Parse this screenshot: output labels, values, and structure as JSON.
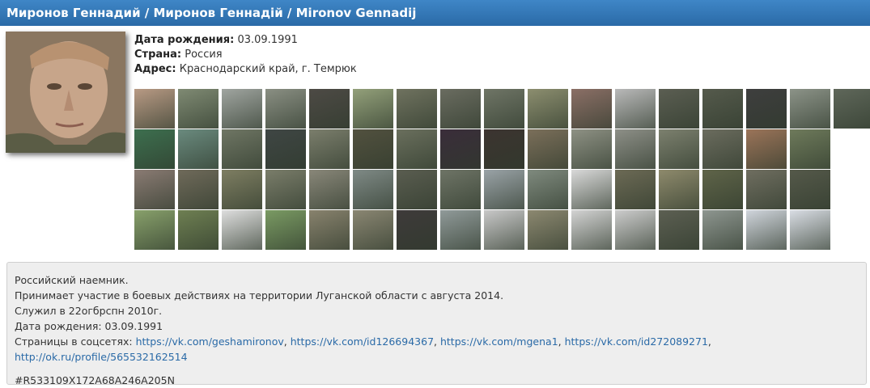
{
  "header": {
    "title": "Миронов Геннадий / Миронов Геннадій / Mironov Gennadij"
  },
  "info": [
    {
      "label": "Дата рождения:",
      "value": "03.09.1991"
    },
    {
      "label": "Страна:",
      "value": "Россия"
    },
    {
      "label": "Адрес:",
      "value": "Краснодарский край, г. Темрюк"
    }
  ],
  "photo_rows": [
    [
      "#b89a84",
      "#7f8a73",
      "#a0a5a0",
      "#8a8f83",
      "#4d4a45",
      "#93a07a",
      "#6f725f",
      "#6a6c60",
      "#6f7566",
      "#8c8e6f",
      "#8b6f66",
      "#b9b9b9",
      "#5b5e52",
      "#555a4c",
      "#3e3e3e",
      "#8c9388",
      "#5f675a"
    ],
    [
      "#3d6f4f",
      "#6a8a7e",
      "#6f7664",
      "#3f4644",
      "#7b7e6c",
      "#52513f",
      "#6a6f5d",
      "#3a2d3a",
      "#3c3430",
      "#7b6f5a",
      "#8e9184",
      "#8d8f87",
      "#7c806e",
      "#6b6c5e",
      "#9b7459",
      "#6e7a5b"
    ],
    [
      "#8a7b73",
      "#6f6a5a",
      "#7e7e62",
      "#7a7d6a",
      "#898779",
      "#7f8a86",
      "#5a5d50",
      "#6e7466",
      "#9aa3a7",
      "#7f8a7e",
      "#d9d9d9",
      "#6c6a55",
      "#8e8a6c",
      "#5f6449",
      "#6f6e60",
      "#55594a"
    ],
    [
      "#88a06b",
      "#6e7f52",
      "#dedede",
      "#7a9a63",
      "#88826d",
      "#8a8672",
      "#3e3a3a",
      "#909a99",
      "#c8c8c8",
      "#8c8870",
      "#d3d3d3",
      "#cccccc",
      "#5c5f52",
      "#8e9690",
      "#d0d5dc",
      "#d9dde4"
    ]
  ],
  "description": {
    "lines": [
      "Российский наемник.",
      "Принимает участие в боевых действиях на территории Луганской области с августа 2014.",
      "Служил в 22огбрспн 2010г.",
      "Дата рождения: 03.09.1991"
    ],
    "socials_label": "Страницы в соцсетях:",
    "links": [
      "https://vk.com/geshamironov",
      "https://vk.com/id126694367",
      "https://vk.com/mgena1",
      "https://vk.com/id272089271",
      "http://ok.ru/profile/565532162514"
    ],
    "tag": "#R533109X172A68A246A205N"
  },
  "colors": {
    "header": "#2f73b5",
    "link": "#2a6aa7",
    "panel": "#eeeeee"
  }
}
